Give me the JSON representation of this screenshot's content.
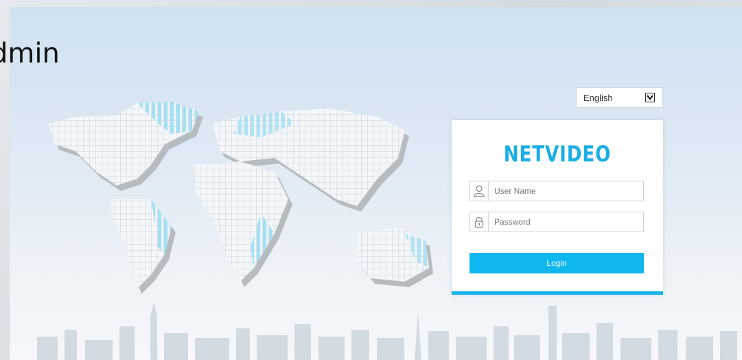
{
  "overlay_title": "dmin",
  "language": {
    "selected": "English",
    "icon": "chevron-down-icon"
  },
  "login": {
    "brand": "NETVIDEO",
    "username_placeholder": "User Name",
    "username_value": "",
    "username_icon": "user-icon",
    "password_placeholder": "Password",
    "password_value": "",
    "password_icon": "lock-icon",
    "button_label": "Login"
  },
  "colors": {
    "accent": "#19b3ec",
    "button": "#10b6ef",
    "brand": "#19aee6"
  }
}
